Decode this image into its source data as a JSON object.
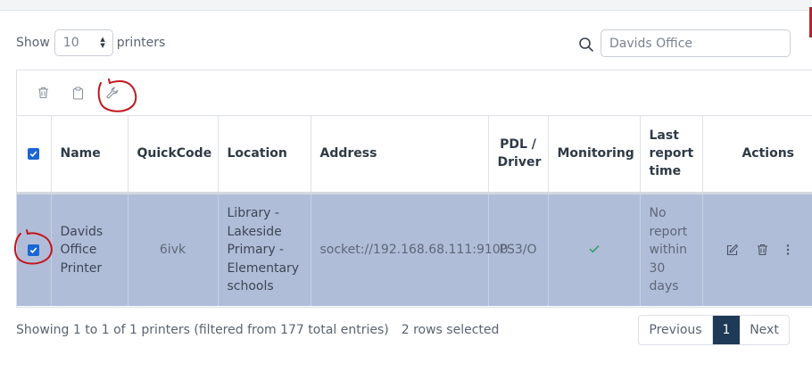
{
  "length_menu": {
    "prefix": "Show",
    "value": "10",
    "suffix": "printers"
  },
  "search": {
    "value": "Davids Office"
  },
  "table": {
    "columns": [
      "Name",
      "QuickCode",
      "Location",
      "Address",
      "PDL / Driver",
      "Monitoring",
      "Last report time",
      "Actions"
    ],
    "rows": [
      {
        "selected": true,
        "name": "Davids Office Printer",
        "quickcode": "6ivk",
        "location": "Library - Lakeside Primary - Elementary schools",
        "address": "socket://192.168.68.111:9100",
        "pdl": "PS3/O",
        "monitoring": "check",
        "last_report": "No report within 30 days"
      }
    ]
  },
  "footer": {
    "info": "Showing 1 to 1 of 1 printers (filtered from 177 total entries)",
    "selected": "2 rows selected"
  },
  "pagination": {
    "previous": "Previous",
    "current": "1",
    "next": "Next"
  },
  "colors": {
    "selected_row": "#b0bdd9",
    "accent": "#1a66d4",
    "pager_active": "#1f3a56",
    "annotation": "#c3151d",
    "monitor_ok": "#2e9d6b"
  }
}
